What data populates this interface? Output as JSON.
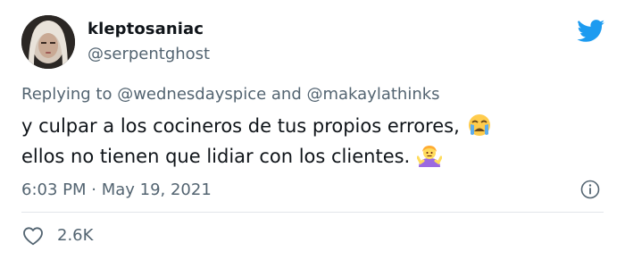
{
  "user": {
    "display_name": "kleptosaniac",
    "handle": "@serpentghost"
  },
  "reply": {
    "prefix": "Replying to ",
    "mention_1": "@wednesdayspice",
    "joiner": " and ",
    "mention_2": "@makaylathinks"
  },
  "tweet": {
    "line_1": "y culpar a los cocineros de tus propios errores,",
    "line_2": "ellos no tienen que lidiar con los clientes.",
    "emoji_1": "crying-face-emoji",
    "emoji_2": "person-shrugging-emoji"
  },
  "meta": {
    "timestamp": "6:03 PM · May 19, 2021"
  },
  "engagement": {
    "likes": "2.6K"
  },
  "icons": {
    "brand": "twitter-bird-icon",
    "info": "info-icon",
    "like": "heart-icon"
  },
  "colors": {
    "brand_blue": "#1d9bf0",
    "text_primary": "#0f1419",
    "text_secondary": "#536471"
  }
}
